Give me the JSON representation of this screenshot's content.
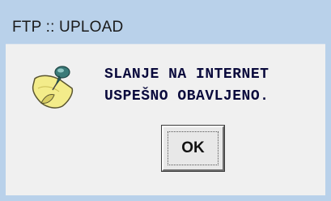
{
  "window": {
    "title": "FTP :: UPLOAD",
    "title_bar_color": "#b9d1ea"
  },
  "dialog": {
    "icon": "pushpin-note-icon",
    "message_line_1": "SLANJE NA INTERNET",
    "message_line_2": "USPEŠNO OBAVLJENO.",
    "ok_label": "OK"
  }
}
